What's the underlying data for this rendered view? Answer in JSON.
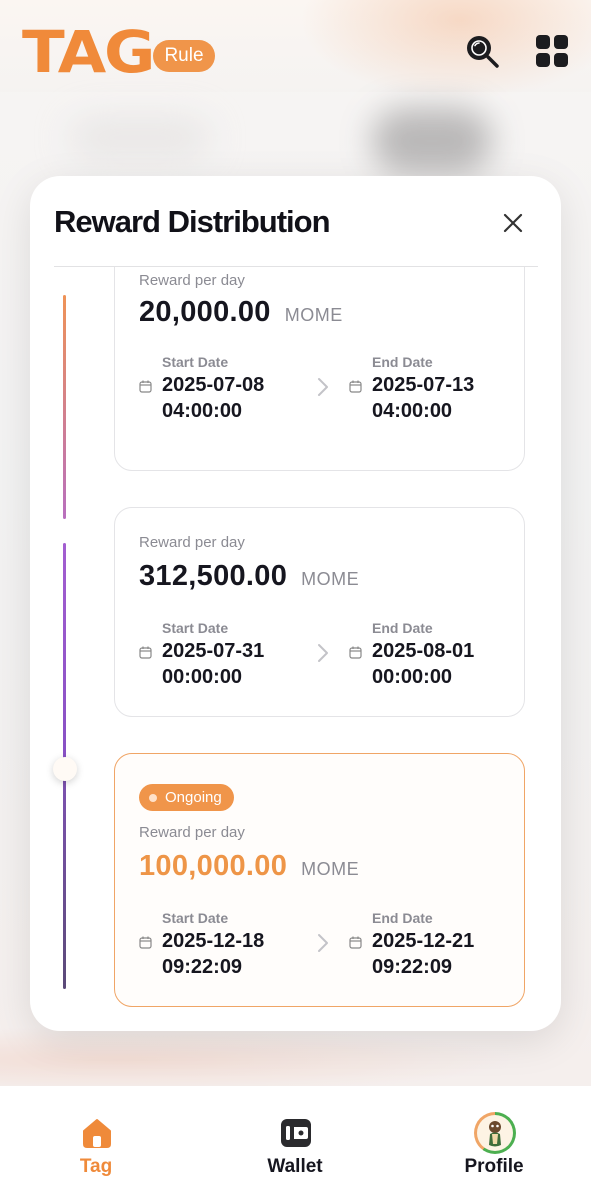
{
  "app": {
    "logo_text": "TAG",
    "rule_label": "Rule",
    "brand_color": "#F08A3A",
    "icons": [
      "search-icon",
      "grid-icon"
    ]
  },
  "modal": {
    "title": "Reward Distribution",
    "close_icon": "close-icon",
    "cards": [
      {
        "status": "",
        "reward_label": "Reward per day",
        "amount": "20,000.00",
        "unit": "MOME",
        "start_label": "Start Date",
        "start_value": "2025-07-08\n04:00:00",
        "end_label": "End Date",
        "end_value": "2025-07-13\n04:00:00"
      },
      {
        "status": "",
        "reward_label": "Reward per day",
        "amount": "312,500.00",
        "unit": "MOME",
        "start_label": "Start Date",
        "start_value": "2025-07-31\n00:00:00",
        "end_label": "End Date",
        "end_value": "2025-08-01\n00:00:00"
      },
      {
        "status": "Ongoing",
        "reward_label": "Reward per day",
        "amount": "100,000.00",
        "unit": "MOME",
        "start_label": "Start Date",
        "start_value": "2025-12-18\n09:22:09",
        "end_label": "End Date",
        "end_value": "2025-12-21\n09:22:09"
      }
    ]
  },
  "bottom_nav": {
    "items": [
      {
        "label": "Tag",
        "icon": "home-icon",
        "active": true
      },
      {
        "label": "Wallet",
        "icon": "wallet-icon",
        "active": false
      },
      {
        "label": "Profile",
        "icon": "avatar",
        "active": false
      }
    ]
  }
}
